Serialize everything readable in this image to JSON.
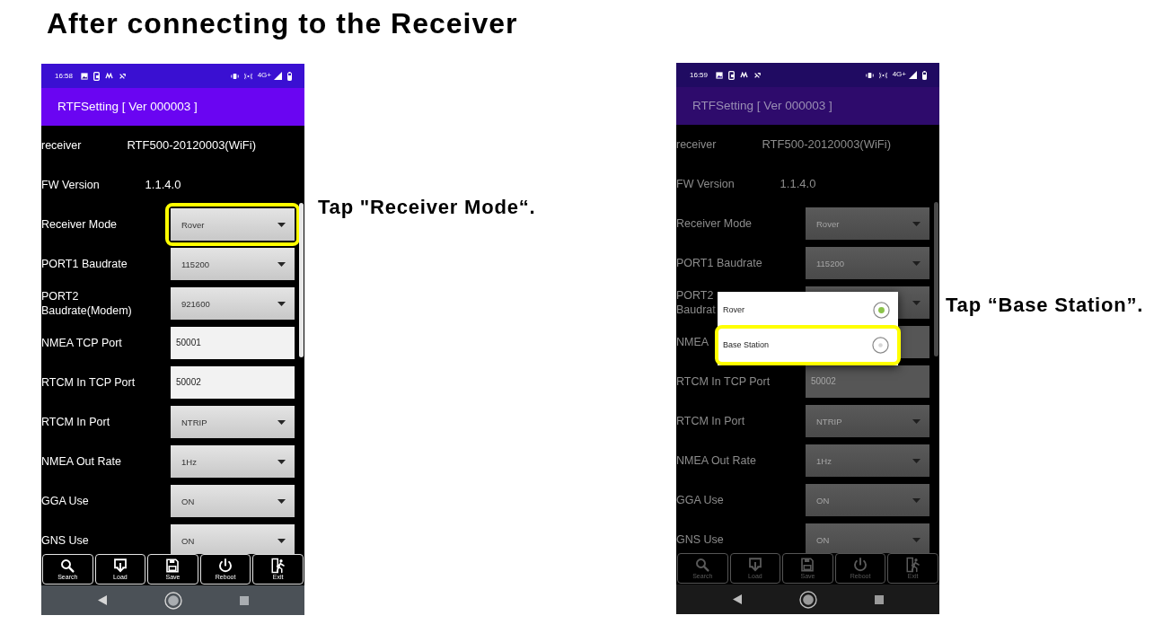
{
  "title": "After connecting to the Receiver",
  "steps": [
    {
      "phone": {
        "status_bar": {
          "time": "16:58",
          "network": "4G+"
        },
        "app_title": "RTFSetting [ Ver 000003 ]",
        "fields": [
          {
            "kind": "info",
            "label": "receiver",
            "value": "RTF500-20120003(WiFi)",
            "highlighted": false
          },
          {
            "kind": "info",
            "label": "FW Version",
            "value": "1.1.4.0",
            "highlighted": false
          },
          {
            "kind": "dropdown",
            "label": "Receiver Mode",
            "value": "Rover",
            "highlighted": true
          },
          {
            "kind": "dropdown",
            "label": "PORT1 Baudrate",
            "value": "115200",
            "highlighted": false
          },
          {
            "kind": "dropdown",
            "label": "PORT2\nBaudrate(Modem)",
            "value": "921600",
            "highlighted": false
          },
          {
            "kind": "text_input",
            "label": "NMEA TCP Port",
            "value": "50001",
            "highlighted": false
          },
          {
            "kind": "text_input",
            "label": "RTCM In TCP Port",
            "value": "50002",
            "highlighted": false
          },
          {
            "kind": "dropdown",
            "label": "RTCM In Port",
            "value": "NTRIP",
            "highlighted": false
          },
          {
            "kind": "dropdown",
            "label": "NMEA Out Rate",
            "value": "1Hz",
            "highlighted": false
          },
          {
            "kind": "dropdown",
            "label": "GGA Use",
            "value": "ON",
            "highlighted": false
          },
          {
            "kind": "dropdown",
            "label": "GNS Use",
            "value": "ON",
            "highlighted": false
          }
        ],
        "toolbar": [
          "Search",
          "Load",
          "Save",
          "Reboot",
          "Exit"
        ]
      },
      "instruction": "Tap \"Receiver Mode“."
    },
    {
      "phone": {
        "status_bar": {
          "time": "16:59",
          "network": "4G+"
        },
        "app_title": "RTFSetting [ Ver 000003 ]",
        "fields": [
          {
            "kind": "info",
            "label": "receiver",
            "value": "RTF500-20120003(WiFi)",
            "highlighted": false
          },
          {
            "kind": "info",
            "label": "FW Version",
            "value": "1.1.4.0",
            "highlighted": false
          },
          {
            "kind": "dropdown",
            "label": "Receiver Mode",
            "value": "Rover",
            "highlighted": false
          },
          {
            "kind": "dropdown",
            "label": "PORT1 Baudrate",
            "value": "115200",
            "highlighted": false
          },
          {
            "kind": "dropdown",
            "label": "PORT2\nBaudrat",
            "highlighted": false
          },
          {
            "kind": "text_input",
            "label": "NMEA",
            "highlighted": false
          },
          {
            "kind": "text_input",
            "label": "RTCM In TCP Port",
            "value": "50002",
            "highlighted": false
          },
          {
            "kind": "dropdown",
            "label": "RTCM In Port",
            "value": "NTRIP",
            "highlighted": false
          },
          {
            "kind": "dropdown",
            "label": "NMEA Out Rate",
            "value": "1Hz",
            "highlighted": false
          },
          {
            "kind": "dropdown",
            "label": "GGA Use",
            "value": "ON",
            "highlighted": false
          },
          {
            "kind": "dropdown",
            "label": "GNS Use",
            "value": "ON",
            "highlighted": false
          }
        ],
        "toolbar": [
          "Search",
          "Load",
          "Save",
          "Reboot",
          "Exit"
        ],
        "dialog": {
          "options": [
            {
              "label": "Rover",
              "selected": true,
              "highlighted": false
            },
            {
              "label": "Base Station",
              "selected": false,
              "highlighted": true
            }
          ]
        }
      },
      "instruction": "Tap “Base Station”."
    }
  ]
}
